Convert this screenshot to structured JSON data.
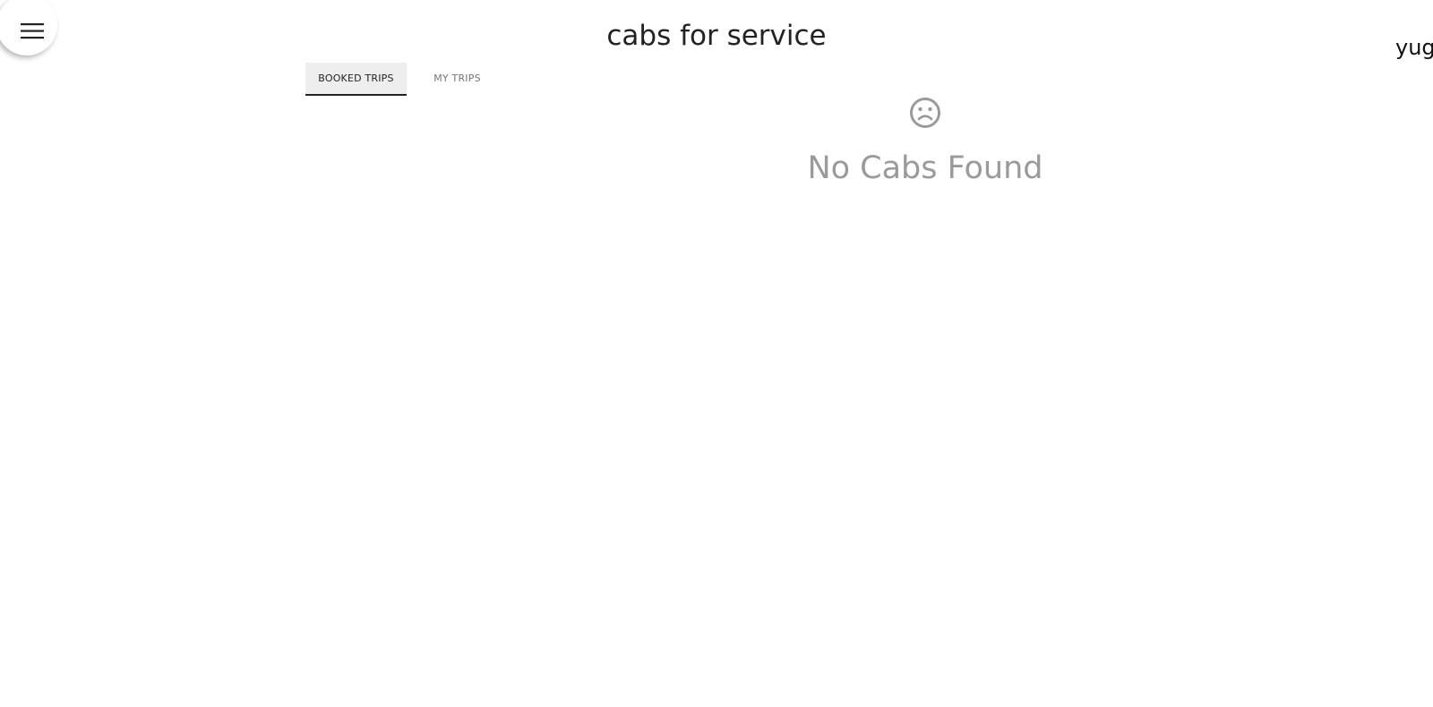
{
  "header": {
    "title": "cabs for service",
    "user_name": "yug",
    "menu_icon": "hamburger-menu-icon"
  },
  "tabs": [
    {
      "label": "BOOKED TRIPS",
      "active": true
    },
    {
      "label": "MY TRIPS",
      "active": false
    }
  ],
  "empty_state": {
    "icon": "sad-face-icon",
    "message": "No Cabs Found"
  },
  "colors": {
    "title_text": "#222222",
    "active_tab_bg": "#eeeeee",
    "active_tab_underline": "#222222",
    "inactive_tab_text": "#777777",
    "empty_state_text": "#9a9a9a"
  }
}
